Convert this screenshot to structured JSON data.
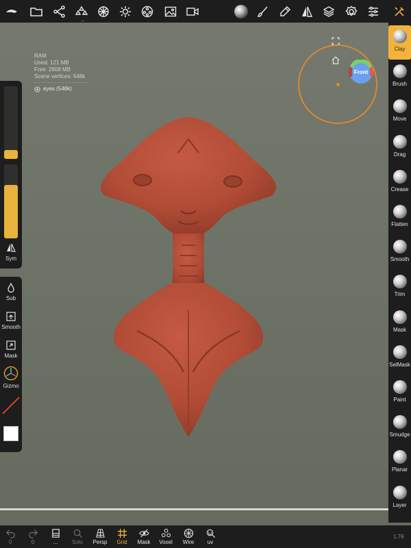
{
  "colors": {
    "accent": "#f3b33b",
    "panel": "#1c1d1c",
    "model": "#b8503a",
    "orbit": "#d9892f"
  },
  "topbar": {
    "icons": [
      {
        "name": "logo-icon"
      },
      {
        "name": "folder-icon"
      },
      {
        "name": "scene-graph-icon"
      },
      {
        "name": "primitives-icon"
      },
      {
        "name": "material-sphere-icon"
      },
      {
        "name": "light-icon"
      },
      {
        "name": "film-reel-icon"
      },
      {
        "name": "image-icon"
      },
      {
        "name": "video-icon"
      },
      {
        "name": "material-ball-icon"
      },
      {
        "name": "brush-icon"
      },
      {
        "name": "pen-icon"
      },
      {
        "name": "mirror-icon"
      },
      {
        "name": "layers-icon"
      },
      {
        "name": "settings-gear-icon"
      },
      {
        "name": "sliders-icon"
      },
      {
        "name": "tools-icon"
      }
    ],
    "dots": "..."
  },
  "stats": {
    "ram_label": "RAM",
    "used": "Used: 121 MB",
    "free": "Free: 2908 MB",
    "vertices": "Scene vertices: 548k",
    "mesh_name": "eyes (548k)"
  },
  "orientation": {
    "face_label": "Front"
  },
  "left_panel": {
    "sym_label": "Sym",
    "tools": [
      {
        "label": "Sub",
        "icon": "drop-icon"
      },
      {
        "label": "Smooth",
        "icon": "smooth-up-icon"
      },
      {
        "label": "Mask",
        "icon": "mask-box-icon"
      },
      {
        "label": "Gizmo",
        "icon": "gizmo-icon"
      }
    ],
    "radius_value": 0.12,
    "intensity_value": 0.72
  },
  "right_tools": [
    {
      "label": "Clay",
      "active": true
    },
    {
      "label": "Brush"
    },
    {
      "label": "Move"
    },
    {
      "label": "Drag"
    },
    {
      "label": "Crease"
    },
    {
      "label": "Flatten"
    },
    {
      "label": "Smooth"
    },
    {
      "label": "Trim"
    },
    {
      "label": "Mask"
    },
    {
      "label": "SelMask"
    },
    {
      "label": "Paint"
    },
    {
      "label": "Smudge"
    },
    {
      "label": "Planar"
    },
    {
      "label": "Layer"
    }
  ],
  "bottom": {
    "undo_count": "0",
    "redo_count": "0",
    "items": [
      {
        "label": "...",
        "icon": "stack-icon"
      },
      {
        "label": "Solo",
        "icon": "solo-search-icon"
      },
      {
        "label": "Persp",
        "icon": "perspective-icon"
      },
      {
        "label": "Grid",
        "icon": "grid-icon"
      },
      {
        "label": "Mask",
        "icon": "eye-mask-icon"
      },
      {
        "label": "Voxel",
        "icon": "voxel-icon"
      },
      {
        "label": "Wire",
        "icon": "wire-icon"
      },
      {
        "label": "uv",
        "icon": "uv-icon"
      }
    ],
    "version": "1.76"
  }
}
